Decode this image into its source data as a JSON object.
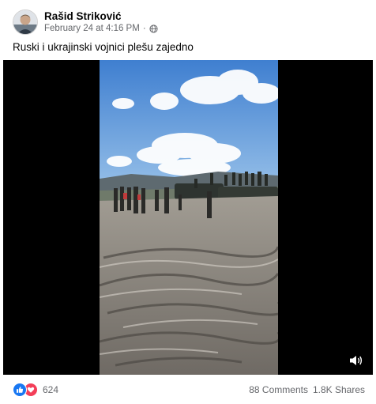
{
  "post": {
    "author": "Rašid Striković",
    "timestamp": "February 24 at 4:16 PM",
    "separator": "·",
    "audience_icon": "globe-icon",
    "caption": "Ruski i ukrajinski vojnici plešu zajedno"
  },
  "video": {
    "content": "soldiers-dancing-on-muddy-field-video",
    "volume_icon": "volume-icon",
    "colors": {
      "letterbox": "#000000",
      "sky": "#4f8fd6",
      "mud": "#8f8a84"
    }
  },
  "footer": {
    "reaction_icons": [
      "like-icon",
      "love-icon"
    ],
    "reaction_count": "624",
    "comments": "88 Comments",
    "shares": "1.8K Shares"
  },
  "colors": {
    "primary_text": "#050505",
    "secondary_text": "#65676b",
    "like": "#1877f2",
    "love": "#f33e58"
  }
}
